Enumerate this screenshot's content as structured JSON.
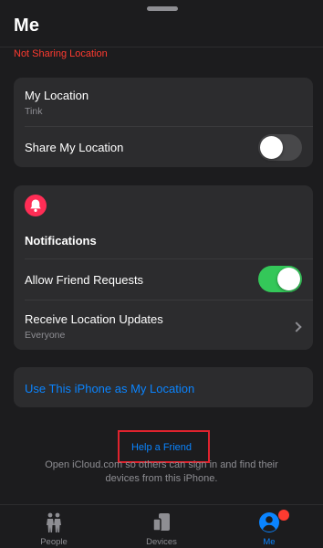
{
  "header": {
    "title": "Me",
    "status": "Not Sharing Location"
  },
  "location_card": {
    "my_location_label": "My Location",
    "my_location_value": "Tink",
    "share_label": "Share My Location",
    "share_enabled": false
  },
  "notifications_card": {
    "icon": "bell-icon",
    "heading": "Notifications",
    "friend_requests_label": "Allow Friend Requests",
    "friend_requests_enabled": true,
    "updates_label": "Receive Location Updates",
    "updates_value": "Everyone"
  },
  "use_iphone_label": "Use This iPhone as My Location",
  "help": {
    "link": "Help a Friend",
    "description": "Open iCloud.com so others can sign in and find their devices from this iPhone."
  },
  "tabbar": {
    "tabs": [
      {
        "label": "People",
        "icon": "people-icon",
        "active": false
      },
      {
        "label": "Devices",
        "icon": "devices-icon",
        "active": false
      },
      {
        "label": "Me",
        "icon": "person-icon",
        "active": true
      }
    ]
  },
  "colors": {
    "accent": "#0a84ff",
    "toggle_on": "#34c759",
    "alert": "#ff3b30",
    "bell_badge": "#ff2d55"
  }
}
